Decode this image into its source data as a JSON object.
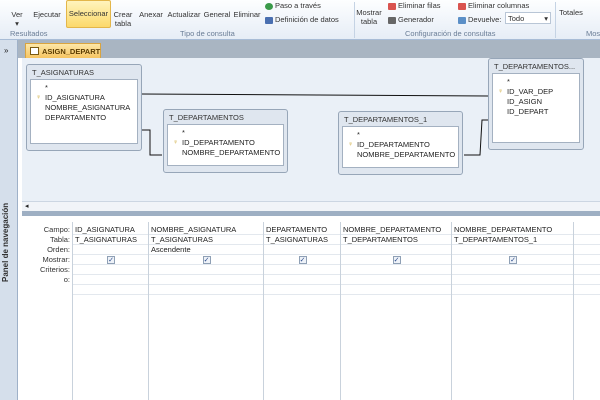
{
  "ribbon": {
    "buttons": {
      "ver": "Ver",
      "ejecutar": "Ejecutar",
      "seleccionar": "Seleccionar",
      "crear_tabla": "Crear tabla",
      "anexar": "Anexar",
      "actualizar": "Actualizar",
      "general": "General",
      "eliminar": "Eliminar",
      "paso": "Paso a través",
      "definicion": "Definición de datos",
      "mostrar_tabla": "Mostrar tabla",
      "eliminar_filas": "Eliminar filas",
      "generador": "Generador",
      "eliminar_columnas": "Eliminar columnas",
      "devuelve": "Devuelve:",
      "devuelve_value": "Todo",
      "totales": "Totales"
    },
    "groups": {
      "resultados": "Resultados",
      "tipo": "Tipo de consulta",
      "config": "Configuración de consultas",
      "mostrar": "Mos"
    }
  },
  "tab": {
    "title": "ASIGN_DEPART"
  },
  "nav": {
    "title": "Panel de navegación",
    "toggle": "»"
  },
  "tables": [
    {
      "name": "T_ASIGNATURAS",
      "fields": [
        "*",
        "ID_ASIGNATURA",
        "NOMBRE_ASIGNATURA",
        "DEPARTAMENTO"
      ]
    },
    {
      "name": "T_DEPARTAMENTOS",
      "fields": [
        "*",
        "ID_DEPARTAMENTO",
        "NOMBRE_DEPARTAMENTO"
      ]
    },
    {
      "name": "T_DEPARTAMENTOS_1",
      "fields": [
        "*",
        "ID_DEPARTAMENTO",
        "NOMBRE_DEPARTAMENTO"
      ]
    },
    {
      "name": "T_DEPARTAMENTOS...",
      "fields": [
        "*",
        "ID_VAR_DEP",
        "ID_ASIGN",
        "ID_DEPART"
      ]
    }
  ],
  "grid": {
    "row_labels": [
      "Campo:",
      "Tabla:",
      "Orden:",
      "Mostrar:",
      "Criterios:",
      "o:"
    ],
    "columns": [
      {
        "campo": "ID_ASIGNATURA",
        "tabla": "T_ASIGNATURAS",
        "orden": "",
        "mostrar": true
      },
      {
        "campo": "NOMBRE_ASIGNATURA",
        "tabla": "T_ASIGNATURAS",
        "orden": "Ascendente",
        "mostrar": true
      },
      {
        "campo": "DEPARTAMENTO",
        "tabla": "T_ASIGNATURAS",
        "orden": "",
        "mostrar": true
      },
      {
        "campo": "NOMBRE_DEPARTAMENTO",
        "tabla": "T_DEPARTAMENTOS",
        "orden": "",
        "mostrar": true
      },
      {
        "campo": "NOMBRE_DEPARTAMENTO",
        "tabla": "T_DEPARTAMENTOS_1",
        "orden": "",
        "mostrar": true
      }
    ]
  }
}
